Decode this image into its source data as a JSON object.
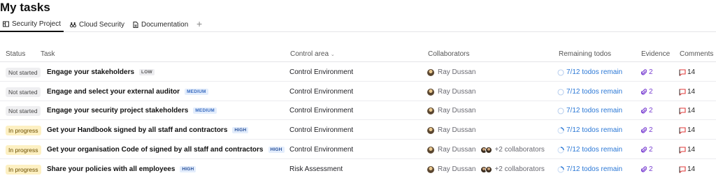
{
  "page": {
    "title": "My tasks"
  },
  "tabs": [
    {
      "label": "Security Project",
      "icon": "board-icon",
      "active": true
    },
    {
      "label": "Cloud Security",
      "icon": "binoculars-icon",
      "active": false
    },
    {
      "label": "Documentation",
      "icon": "document-icon",
      "active": false
    }
  ],
  "add_tab_glyph": "+",
  "columns": {
    "status": "Status",
    "task": "Task",
    "control_area": "Control area",
    "collaborators": "Collaborators",
    "remaining": "Remaining todos",
    "evidence": "Evidence",
    "comments": "Comments"
  },
  "colors": {
    "link_blue": "#2b78d6",
    "evidence_purple": "#7a3fd1",
    "comment_red": "#e03b3b",
    "in_progress_bg": "#fdf0c2"
  },
  "rows": [
    {
      "status": "Not started",
      "status_type": "ns",
      "task": "Engage your stakeholders",
      "priority": "LOW",
      "priority_type": "low",
      "area": "Control Environment",
      "collaborator": "Ray Dussan",
      "extra": "",
      "todos": "7/12 todos remain",
      "evidence": "2",
      "comments": "14"
    },
    {
      "status": "Not started",
      "status_type": "ns",
      "task": "Engage and select your external auditor",
      "priority": "MEDIUM",
      "priority_type": "medium",
      "area": "Control Environment",
      "collaborator": "Ray Dussan",
      "extra": "",
      "todos": "7/12 todos remain",
      "evidence": "2",
      "comments": "14"
    },
    {
      "status": "Not started",
      "status_type": "ns",
      "task": "Engage your security project stakeholders",
      "priority": "MEDIUM",
      "priority_type": "medium",
      "area": "Control Environment",
      "collaborator": "Ray Dussan",
      "extra": "",
      "todos": "7/12 todos remain",
      "evidence": "2",
      "comments": "14"
    },
    {
      "status": "In progress",
      "status_type": "ip",
      "task": "Get your Handbook signed by all staff and contractors",
      "priority": "HIGH",
      "priority_type": "high",
      "area": "Control Environment",
      "collaborator": "Ray Dussan",
      "extra": "",
      "todos": "7/12 todos remain",
      "evidence": "2",
      "comments": "14"
    },
    {
      "status": "In progress",
      "status_type": "ip",
      "task": "Get your organisation Code of signed by all staff and contractors",
      "priority": "HIGH",
      "priority_type": "high",
      "area": "Control Environment",
      "collaborator": "Ray Dussan",
      "extra": "+2 collaborators",
      "todos": "7/12 todos remain",
      "evidence": "2",
      "comments": "14"
    },
    {
      "status": "In progress",
      "status_type": "ip",
      "task": "Share your policies with all employees",
      "priority": "HIGH",
      "priority_type": "high",
      "area": "Risk Assessment",
      "collaborator": "Ray Dussan",
      "extra": "+2 collaborators",
      "todos": "7/12 todos remain",
      "evidence": "2",
      "comments": "14"
    }
  ]
}
